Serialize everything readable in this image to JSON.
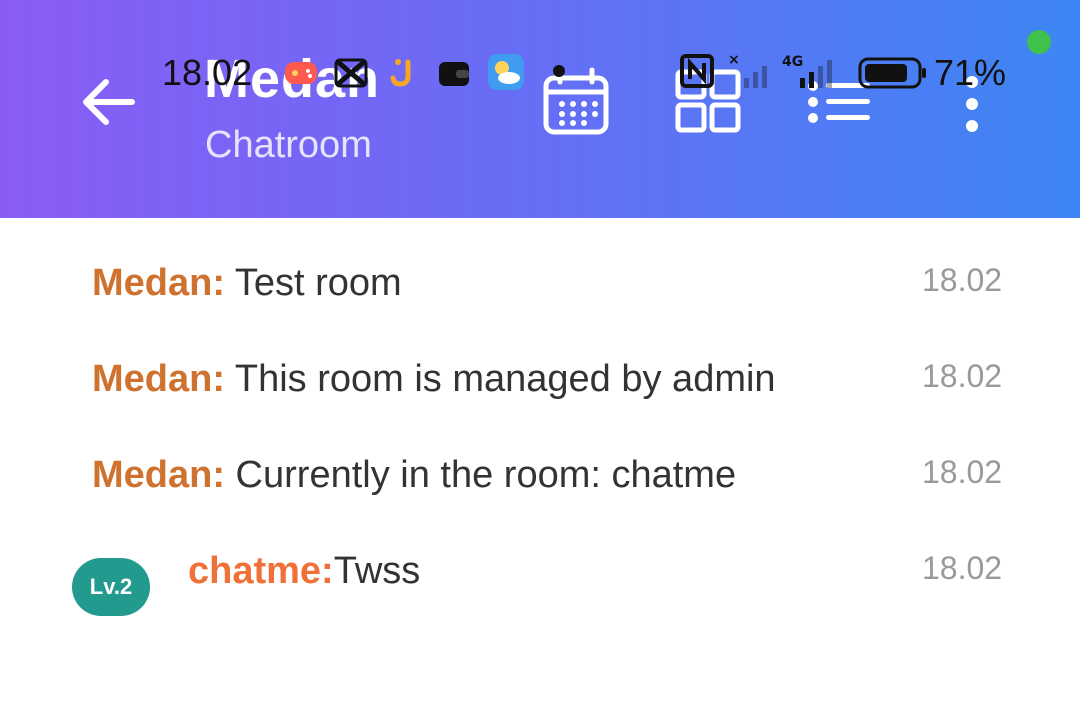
{
  "header": {
    "title": "Medan",
    "subtitle": "Chatroom",
    "icons": [
      "back-arrow-icon",
      "calendar-icon",
      "grid-icon",
      "list-icon",
      "more-vertical-icon"
    ],
    "gradient": [
      "#8a5cf6",
      "#3d86f3"
    ]
  },
  "status_bar": {
    "time": "18.02",
    "battery": "71%",
    "network": "4G",
    "icons": [
      "game-icon",
      "capcut-icon",
      "app-j-icon",
      "wallet-icon",
      "weather-icon",
      "dot-icon",
      "nfc-icon",
      "signal-icon",
      "battery-icon"
    ]
  },
  "messages": [
    {
      "sender": "Medan:",
      "text": " Test room",
      "time": "18.02",
      "type": "system"
    },
    {
      "sender": "Medan:",
      "text": " This room is managed by admin",
      "time": "18.02",
      "type": "system"
    },
    {
      "sender": "Medan:",
      "text": " Currently in the room: chatme",
      "time": "18.02",
      "type": "system"
    },
    {
      "sender": "chatme:",
      "text": "Twss",
      "time": "18.02",
      "type": "user",
      "level": "Lv.2"
    }
  ],
  "colors": {
    "system_sender": "#d0722f",
    "user_sender": "#f07038",
    "level_badge": "#239a8e",
    "timestamp": "#9a9a9a"
  }
}
